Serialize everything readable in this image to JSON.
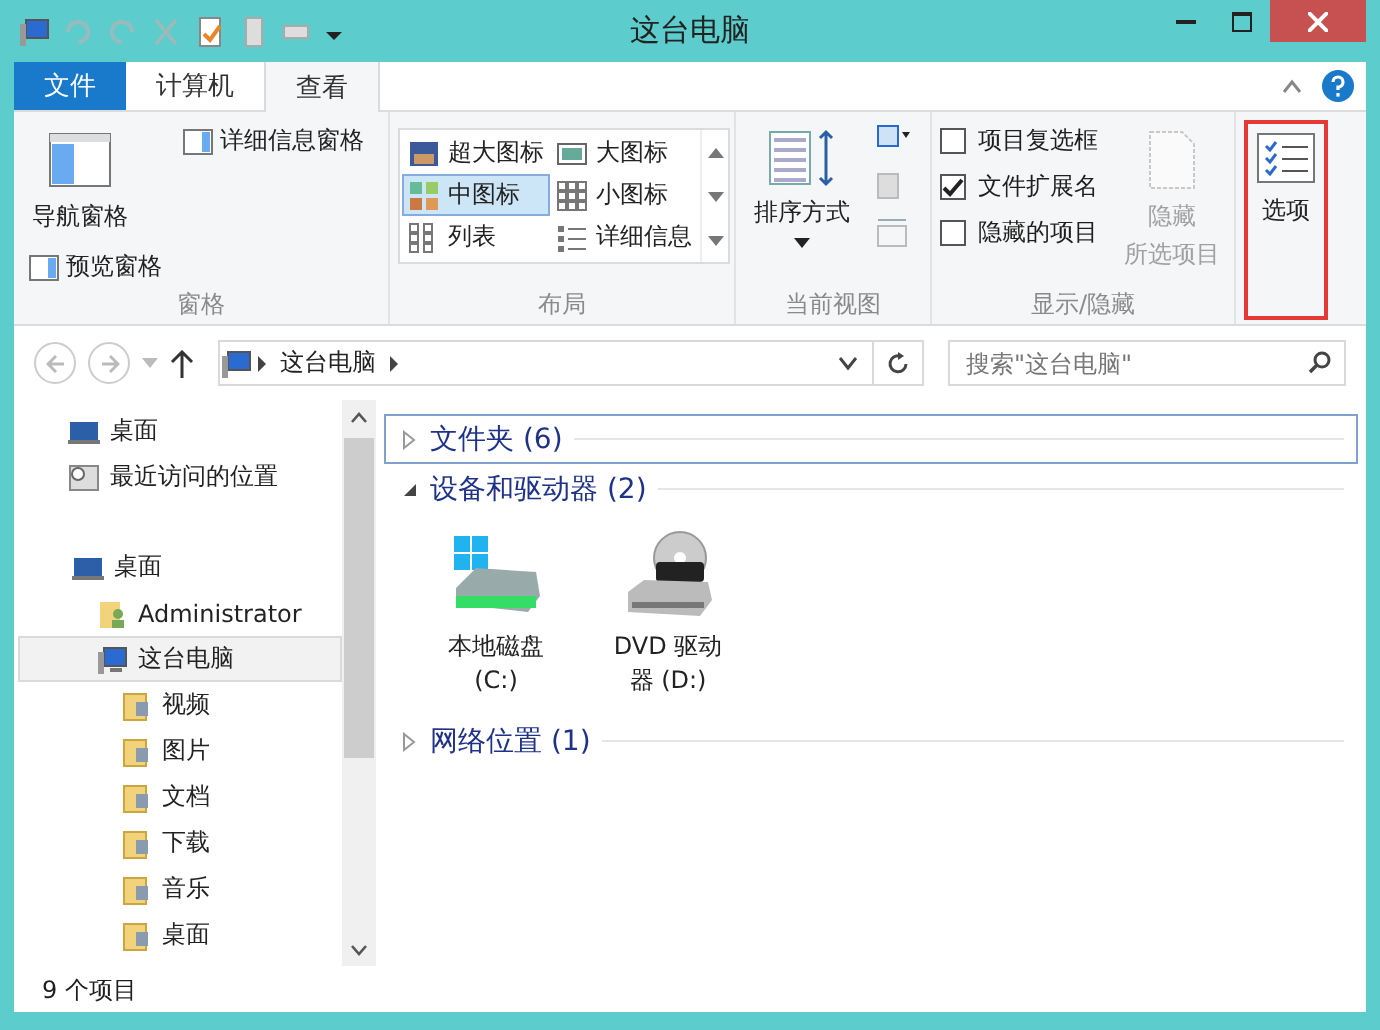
{
  "window": {
    "title": "这台电脑"
  },
  "tabs": [
    {
      "label": "文件",
      "kind": "file",
      "selected": false
    },
    {
      "label": "计算机",
      "kind": "normal",
      "selected": false
    },
    {
      "label": "查看",
      "kind": "normal",
      "selected": true
    }
  ],
  "ribbon": {
    "panes": {
      "title": "窗格",
      "nav_pane": "导航窗格",
      "preview_pane": "预览窗格",
      "details_pane": "详细信息窗格"
    },
    "layout": {
      "title": "布局",
      "items": [
        {
          "label": "超大图标",
          "kind": "xl",
          "selected": false
        },
        {
          "label": "大图标",
          "kind": "large",
          "selected": false
        },
        {
          "label": "中图标",
          "kind": "medium",
          "selected": true
        },
        {
          "label": "小图标",
          "kind": "small",
          "selected": false
        },
        {
          "label": "列表",
          "kind": "list",
          "selected": false
        },
        {
          "label": "详细信息",
          "kind": "details",
          "selected": false
        }
      ]
    },
    "current_view": {
      "title": "当前视图",
      "sort_button": "排序方式"
    },
    "show_hide": {
      "title": "显示/隐藏",
      "checkboxes": [
        {
          "label": "项目复选框",
          "checked": false
        },
        {
          "label": "文件扩展名",
          "checked": true
        },
        {
          "label": "隐藏的项目",
          "checked": false
        }
      ],
      "hide_selected": {
        "lines": [
          "隐藏",
          "所选项目"
        ],
        "disabled": true
      }
    },
    "options": {
      "label": "选项",
      "highlighted": true
    }
  },
  "address": {
    "path": [
      "这台电脑"
    ],
    "search_placeholder": "搜索\"这台电脑\""
  },
  "nav": {
    "quick": [
      {
        "label": "桌面",
        "kind": "desktop",
        "selected": false
      },
      {
        "label": "最近访问的位置",
        "kind": "recent",
        "selected": false
      }
    ],
    "tree": [
      {
        "label": "桌面",
        "kind": "desktop",
        "selected": false,
        "children": [
          {
            "label": "Administrator",
            "kind": "user",
            "selected": false
          },
          {
            "label": "这台电脑",
            "kind": "computer",
            "selected": true,
            "children": [
              {
                "label": "视频",
                "kind": "folder",
                "selected": false
              },
              {
                "label": "图片",
                "kind": "folder",
                "selected": false
              },
              {
                "label": "文档",
                "kind": "folder",
                "selected": false
              },
              {
                "label": "下载",
                "kind": "folder",
                "selected": false
              },
              {
                "label": "音乐",
                "kind": "folder",
                "selected": false
              },
              {
                "label": "桌面",
                "kind": "folder",
                "selected": false
              }
            ]
          }
        ]
      }
    ]
  },
  "sections": [
    {
      "title": "文件夹 (6)",
      "expanded": false,
      "focused": true
    },
    {
      "title": "设备和驱动器 (2)",
      "expanded": true,
      "focused": false,
      "items": [
        {
          "name": "本地磁盘 (C:)",
          "kind": "disk"
        },
        {
          "name": "DVD 驱动器 (D:)",
          "kind": "dvd"
        }
      ]
    },
    {
      "title": "网络位置 (1)",
      "expanded": false,
      "focused": false
    }
  ],
  "status_bar": {
    "count": "9 个项目"
  }
}
